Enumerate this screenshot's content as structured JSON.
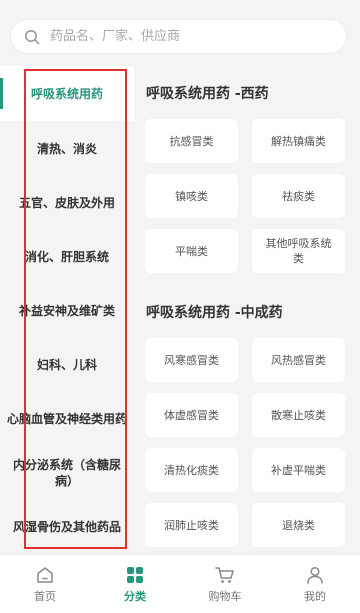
{
  "search": {
    "placeholder": "药品名、厂家、供应商"
  },
  "sidebar": {
    "items": [
      {
        "label": "呼吸系统用药",
        "active": true
      },
      {
        "label": "清热、消炎"
      },
      {
        "label": "五官、皮肤及外用"
      },
      {
        "label": "消化、肝胆系统"
      },
      {
        "label": "补益安神及维矿类"
      },
      {
        "label": "妇科、儿科"
      },
      {
        "label": "心脑血管及神经类用药"
      },
      {
        "label": "内分泌系统（含糖尿病）"
      },
      {
        "label": "风湿骨伤及其他药品"
      }
    ]
  },
  "sections": [
    {
      "title": "呼吸系统用药 -西药",
      "items": [
        "抗感冒类",
        "解热镇痛类",
        "镇咳类",
        "祛痰类",
        "平喘类",
        "其他呼吸系统类"
      ]
    },
    {
      "title": "呼吸系统用药 -中成药",
      "items": [
        "风寒感冒类",
        "风热感冒类",
        "体虚感冒类",
        "散寒止咳类",
        "清热化痰类",
        "补虚平喘类",
        "润肺止咳类",
        "退烧类"
      ]
    }
  ],
  "tabbar": {
    "items": [
      {
        "label": "首页",
        "icon": "home-icon"
      },
      {
        "label": "分类",
        "icon": "category-icon",
        "active": true
      },
      {
        "label": "购物车",
        "icon": "cart-icon"
      },
      {
        "label": "我的",
        "icon": "user-icon"
      }
    ]
  },
  "colors": {
    "accent": "#27967d",
    "highlight": "#e03030",
    "background": "#f4f4f4"
  }
}
